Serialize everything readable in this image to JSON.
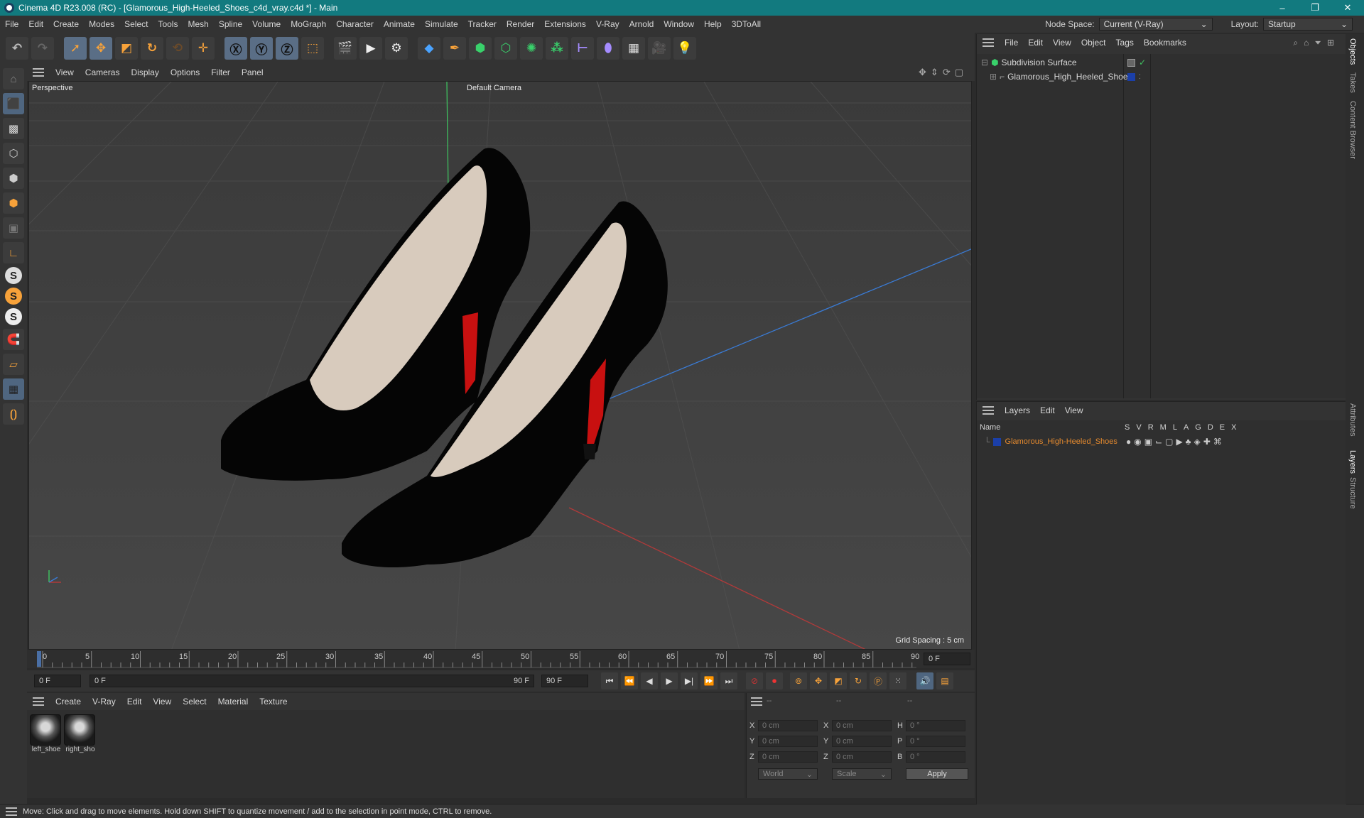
{
  "window": {
    "title": "Cinema 4D R23.008 (RC) - [Glamorous_High-Heeled_Shoes_c4d_vray.c4d *] - Main",
    "controls": [
      "–",
      "❐",
      "✕"
    ]
  },
  "menubar": {
    "items": [
      "File",
      "Edit",
      "Create",
      "Modes",
      "Select",
      "Tools",
      "Mesh",
      "Spline",
      "Volume",
      "MoGraph",
      "Character",
      "Animate",
      "Simulate",
      "Tracker",
      "Render",
      "Extensions",
      "V-Ray",
      "Arnold",
      "Window",
      "Help",
      "3DToAll"
    ],
    "node_space_label": "Node Space:",
    "node_space_value": "Current (V-Ray)",
    "layout_label": "Layout:",
    "layout_value": "Startup"
  },
  "viewport": {
    "menu": [
      "View",
      "Cameras",
      "Display",
      "Options",
      "Filter",
      "Panel"
    ],
    "projection": "Perspective",
    "camera": "Default Camera",
    "grid_spacing": "Grid Spacing : 5 cm"
  },
  "timeline": {
    "ticks": [
      "0",
      "5",
      "10",
      "15",
      "20",
      "25",
      "30",
      "35",
      "40",
      "45",
      "50",
      "55",
      "60",
      "65",
      "70",
      "75",
      "80",
      "85",
      "90"
    ],
    "current_frame": "0 F",
    "start_field": "0 F",
    "range_start": "0 F",
    "range_end": "90 F",
    "end_field": "90 F"
  },
  "materials": {
    "menu": [
      "Create",
      "V-Ray",
      "Edit",
      "View",
      "Select",
      "Material",
      "Texture"
    ],
    "items": [
      {
        "label": "left_shoe"
      },
      {
        "label": "right_sho"
      }
    ]
  },
  "coordinates": {
    "headers": [
      "--",
      "--",
      "--"
    ],
    "rows": [
      {
        "a": "X",
        "av": "0 cm",
        "b": "X",
        "bv": "0 cm",
        "c": "H",
        "cv": "0 °"
      },
      {
        "a": "Y",
        "av": "0 cm",
        "b": "Y",
        "bv": "0 cm",
        "c": "P",
        "cv": "0 °"
      },
      {
        "a": "Z",
        "av": "0 cm",
        "b": "Z",
        "bv": "0 cm",
        "c": "B",
        "cv": "0 °"
      }
    ],
    "space": "World",
    "mode": "Scale",
    "apply": "Apply"
  },
  "objects": {
    "menu": [
      "File",
      "Edit",
      "View",
      "Object",
      "Tags",
      "Bookmarks"
    ],
    "items": [
      {
        "name": "Subdivision Surface"
      },
      {
        "name": "Glamorous_High_Heeled_Shoes"
      }
    ]
  },
  "layers": {
    "menu": [
      "Layers",
      "Edit",
      "View"
    ],
    "name_header": "Name",
    "columns": [
      "S",
      "V",
      "R",
      "M",
      "L",
      "A",
      "G",
      "D",
      "E",
      "X"
    ],
    "items": [
      {
        "name": "Glamorous_High-Heeled_Shoes",
        "color": "#1b3fa8"
      }
    ]
  },
  "side_tabs": [
    "Objects",
    "Takes",
    "Content Browser",
    "Attributes",
    "Layers",
    "Structure"
  ],
  "status": "Move: Click and drag to move elements. Hold down SHIFT to quantize movement / add to the selection in point mode, CTRL to remove.",
  "colors": {
    "titlebar": "#127a7f",
    "accent_orange": "#f7a23a",
    "layer_name": "#e58a2e"
  }
}
